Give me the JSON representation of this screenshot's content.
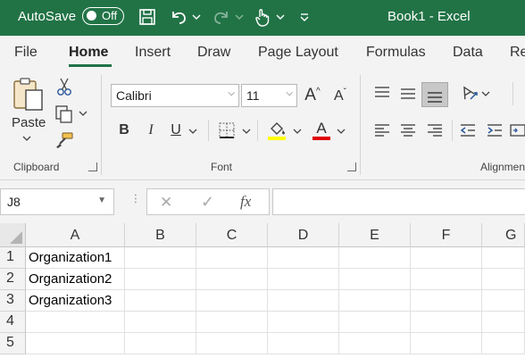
{
  "titlebar": {
    "autosave_label": "AutoSave",
    "autosave_state": "Off",
    "document_title": "Book1  -  Excel",
    "color": "#217346"
  },
  "tabs": [
    {
      "label": "File"
    },
    {
      "label": "Home",
      "active": true
    },
    {
      "label": "Insert"
    },
    {
      "label": "Draw"
    },
    {
      "label": "Page Layout"
    },
    {
      "label": "Formulas"
    },
    {
      "label": "Data"
    },
    {
      "label": "Re"
    }
  ],
  "ribbon": {
    "clipboard": {
      "paste_label": "Paste",
      "group_label": "Clipboard"
    },
    "font": {
      "font_name": "Calibri",
      "font_size": "11",
      "bold": "B",
      "italic": "I",
      "underline": "U",
      "font_color_letter": "A",
      "grow_letter": "A",
      "shrink_letter": "A",
      "group_label": "Font",
      "highlight_color": "#ffff00",
      "font_color": "#e00000"
    },
    "alignment": {
      "group_label": "Alignmen"
    }
  },
  "formula_bar": {
    "name_box_value": "J8",
    "cancel_symbol": "✕",
    "enter_symbol": "✓",
    "fx_symbol": "fx",
    "formula_value": ""
  },
  "sheet": {
    "columns": [
      "A",
      "B",
      "C",
      "D",
      "E",
      "F",
      "G"
    ],
    "rows": [
      "1",
      "2",
      "3",
      "4",
      "5"
    ],
    "cells": {
      "A1": "Organization1",
      "A2": "Organization2",
      "A3": "Organization3"
    }
  }
}
